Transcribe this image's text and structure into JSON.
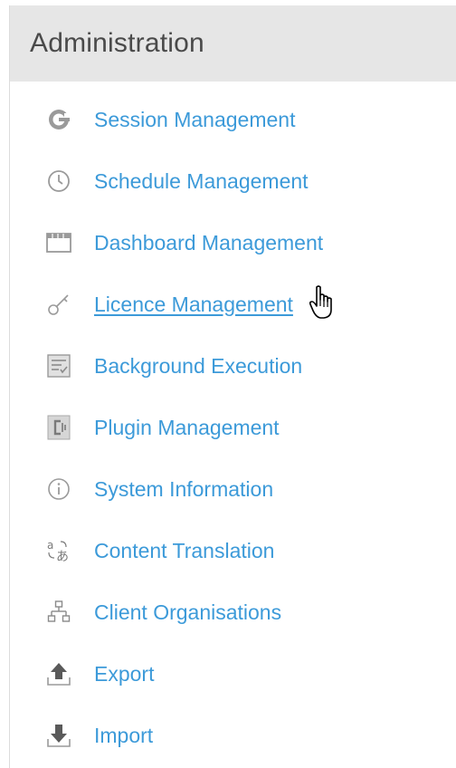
{
  "panel": {
    "title": "Administration",
    "items": [
      {
        "label": "Session Management",
        "icon": "session-icon"
      },
      {
        "label": "Schedule Management",
        "icon": "clock-icon"
      },
      {
        "label": "Dashboard Management",
        "icon": "dashboard-icon"
      },
      {
        "label": "Licence Management",
        "icon": "key-icon"
      },
      {
        "label": "Background Execution",
        "icon": "background-execution-icon"
      },
      {
        "label": "Plugin Management",
        "icon": "plugin-icon"
      },
      {
        "label": "System Information",
        "icon": "info-icon"
      },
      {
        "label": "Content Translation",
        "icon": "translation-icon"
      },
      {
        "label": "Client Organisations",
        "icon": "org-chart-icon"
      },
      {
        "label": "Export",
        "icon": "export-icon"
      },
      {
        "label": "Import",
        "icon": "import-icon"
      }
    ]
  },
  "colors": {
    "link": "#3c9ad9",
    "header_bg": "#e6e6e6",
    "title": "#4a4a4a",
    "icon": "#9a9a9a"
  }
}
